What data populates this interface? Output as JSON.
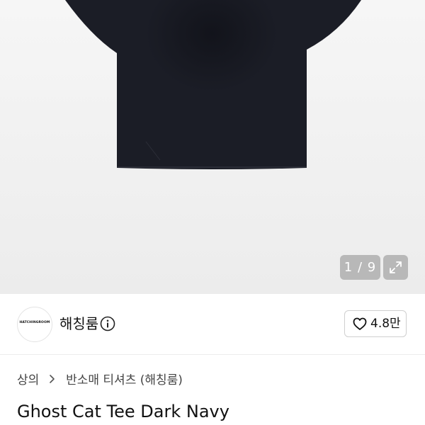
{
  "gallery": {
    "counter": "1 / 9"
  },
  "seller": {
    "logo_text": "HATCHINGROOM",
    "name": "해칭룸",
    "likes": "4.8만"
  },
  "breadcrumb": {
    "category": "상의",
    "subcategory": "반소매 티셔츠 (해칭룸)"
  },
  "product": {
    "title": "Ghost Cat Tee Dark Navy"
  },
  "colors": {
    "shirt": "#1b1d26",
    "gallery_bg": "#f2f2f2",
    "text": "#111111"
  }
}
